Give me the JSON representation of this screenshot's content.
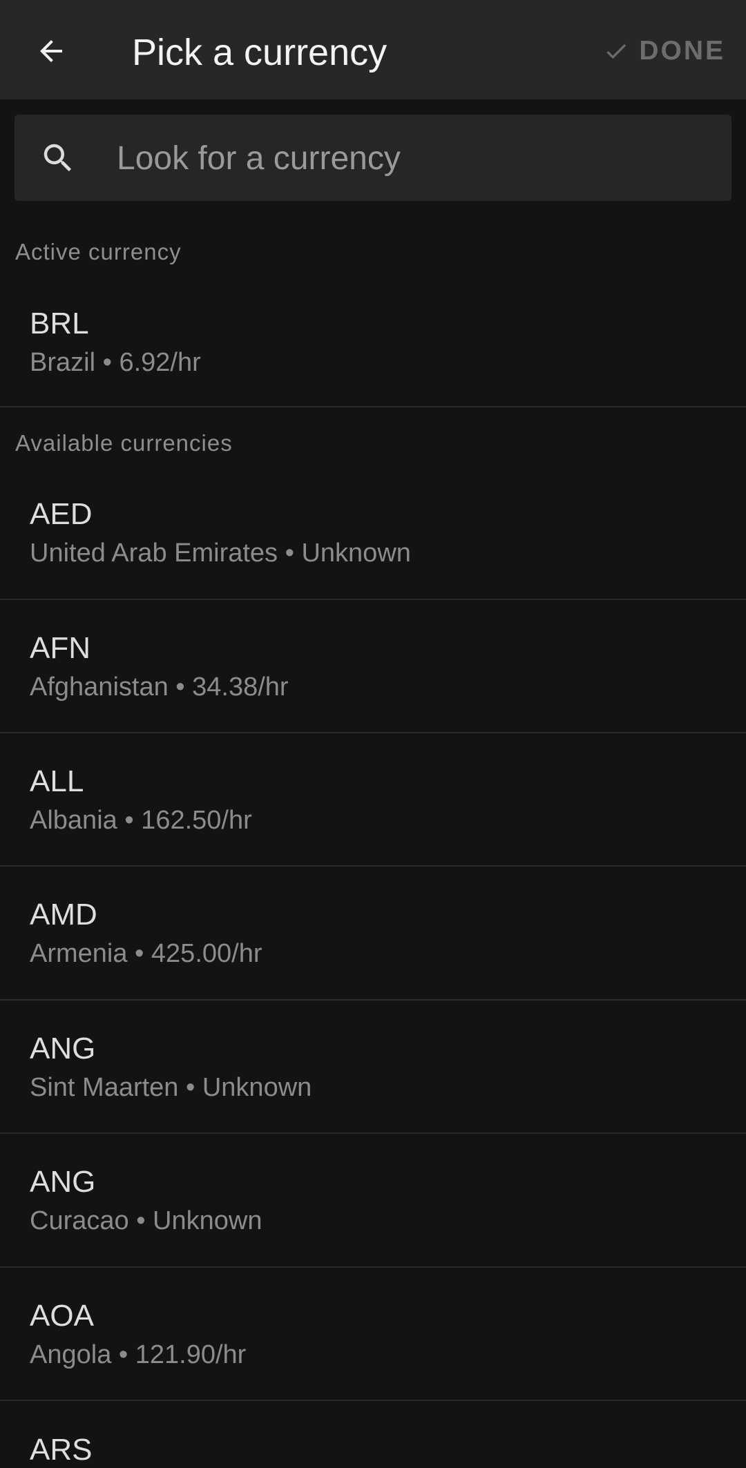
{
  "header": {
    "title": "Pick a currency",
    "done_label": "DONE",
    "back_icon": "arrow-left-icon",
    "done_icon": "check-icon"
  },
  "search": {
    "placeholder": "Look for a currency",
    "value": "",
    "icon": "search-icon"
  },
  "sections": {
    "active_label": "Active currency",
    "available_label": "Available currencies"
  },
  "active": {
    "code": "BRL",
    "detail": "Brazil • 6.92/hr"
  },
  "available": [
    {
      "code": "AED",
      "detail": "United Arab Emirates • Unknown"
    },
    {
      "code": "AFN",
      "detail": "Afghanistan • 34.38/hr"
    },
    {
      "code": "ALL",
      "detail": "Albania • 162.50/hr"
    },
    {
      "code": "AMD",
      "detail": "Armenia • 425.00/hr"
    },
    {
      "code": "ANG",
      "detail": "Sint Maarten • Unknown"
    },
    {
      "code": "ANG",
      "detail": "Curacao • Unknown"
    },
    {
      "code": "AOA",
      "detail": "Angola • 121.90/hr"
    },
    {
      "code": "ARS",
      "detail": ""
    }
  ],
  "colors": {
    "app_bar": "#272727",
    "background": "#131313",
    "search_bg": "#262626",
    "done_disabled": "#6d6d6d"
  }
}
